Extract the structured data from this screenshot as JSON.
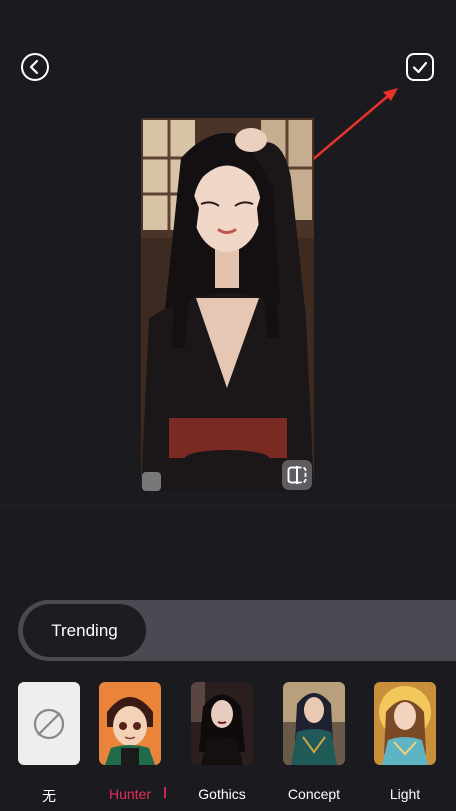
{
  "header": {
    "back_icon": "chevron-left-circle-icon",
    "confirm_icon": "checkmark-square-icon"
  },
  "preview": {
    "subject": "portrait",
    "compare_icon": "compare-split-icon"
  },
  "category_tabs": [
    {
      "label": "Trending",
      "selected": true
    }
  ],
  "styles": [
    {
      "label": "无",
      "icon": "none-slash-icon",
      "selected": false
    },
    {
      "label": "Hunter",
      "selected": true
    },
    {
      "label": "Gothics",
      "selected": false
    },
    {
      "label": "Concept",
      "selected": false
    },
    {
      "label": "Light",
      "selected": false
    }
  ],
  "colors": {
    "background": "#1a1a1f",
    "accent": "#e0305a",
    "annotation_arrow": "#e8322a"
  }
}
